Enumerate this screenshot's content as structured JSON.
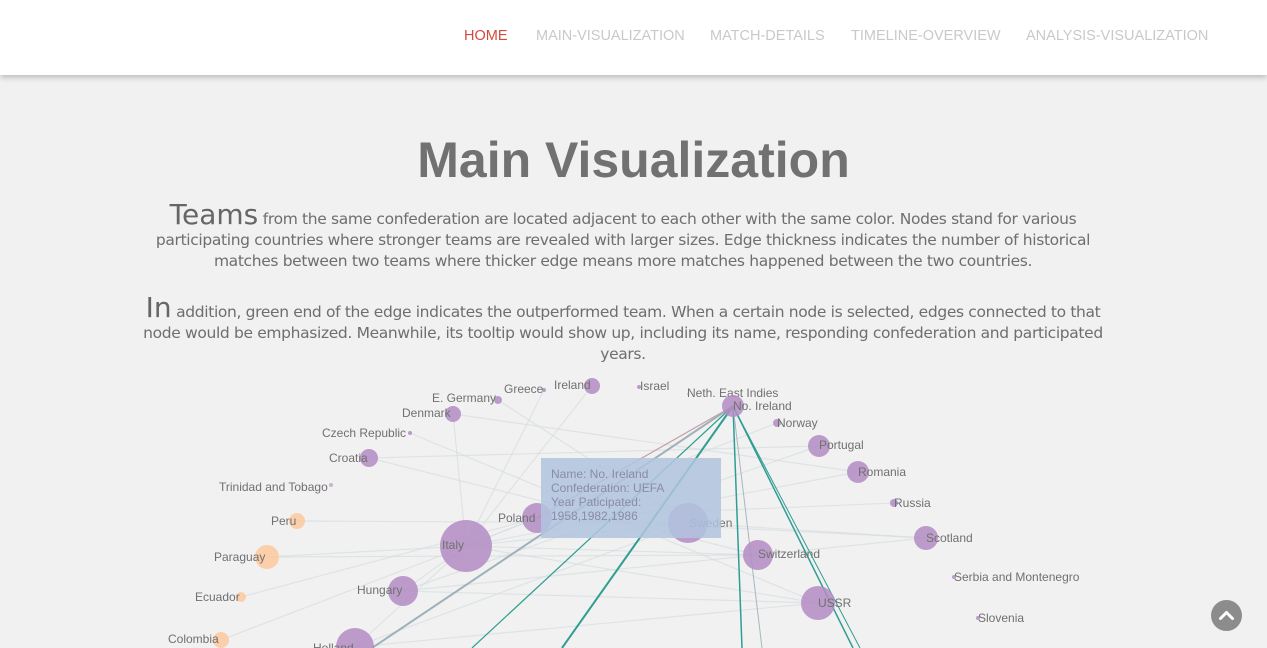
{
  "nav": {
    "items": [
      {
        "label": "HOME",
        "active": true
      },
      {
        "label": "MAIN-VISUALIZATION",
        "active": false
      },
      {
        "label": "MATCH-DETAILS",
        "active": false
      },
      {
        "label": "TIMELINE-OVERVIEW",
        "active": false
      },
      {
        "label": "ANALYSIS-VISUALIZATION",
        "active": false
      }
    ],
    "active_color": "#d2493f",
    "inactive_color": "#c9c9c9"
  },
  "page": {
    "title": "Main Visualization",
    "para1_lead": "Teams",
    "para1_rest": " from the same confederation are located adjacent to each other with the same color. Nodes stand for various participating countries where stronger teams are revealed with larger sizes. Edge thickness indicates the number of historical matches between two teams where thicker edge means more matches happened between the two countries.",
    "para2_lead": "In",
    "para2_rest": " addition, green end of the edge indicates the outperformed team. When a certain node is selected, edges connected to that node would be emphasized. Meanwhile, its tooltip would show up, including its name, responding confederation and participated years."
  },
  "graph": {
    "colors": {
      "uefa": "#b38cc4",
      "conmebol": "#fcc99e",
      "other": "#c4a9c9",
      "edge_highlight": "#2f9e92",
      "edge_faint": "#d5dde0"
    },
    "nodes": [
      {
        "label": "Greece",
        "conf": "UEFA"
      },
      {
        "label": "Ireland",
        "conf": "UEFA"
      },
      {
        "label": "Israel",
        "conf": "UEFA"
      },
      {
        "label": "E. Germany",
        "conf": "UEFA"
      },
      {
        "label": "Neth. East Indies",
        "conf": "AFC"
      },
      {
        "label": "No. Ireland",
        "conf": "UEFA"
      },
      {
        "label": "Denmark",
        "conf": "UEFA"
      },
      {
        "label": "Norway",
        "conf": "UEFA"
      },
      {
        "label": "Czech Republic",
        "conf": "UEFA"
      },
      {
        "label": "Portugal",
        "conf": "UEFA"
      },
      {
        "label": "Croatia",
        "conf": "UEFA"
      },
      {
        "label": "Romania",
        "conf": "UEFA"
      },
      {
        "label": "Trinidad and Tobago",
        "conf": "CONCACAF"
      },
      {
        "label": "Russia",
        "conf": "UEFA"
      },
      {
        "label": "Peru",
        "conf": "CONMEBOL"
      },
      {
        "label": "Poland",
        "conf": "UEFA"
      },
      {
        "label": "Sweden",
        "conf": "UEFA"
      },
      {
        "label": "Scotland",
        "conf": "UEFA"
      },
      {
        "label": "Italy",
        "conf": "UEFA"
      },
      {
        "label": "Paraguay",
        "conf": "CONMEBOL"
      },
      {
        "label": "Switzerland",
        "conf": "UEFA"
      },
      {
        "label": "Serbia and Montenegro",
        "conf": "UEFA"
      },
      {
        "label": "Hungary",
        "conf": "UEFA"
      },
      {
        "label": "Ecuador",
        "conf": "CONMEBOL"
      },
      {
        "label": "USSR",
        "conf": "UEFA"
      },
      {
        "label": "Slovenia",
        "conf": "UEFA"
      },
      {
        "label": "Colombia",
        "conf": "CONMEBOL"
      },
      {
        "label": "Holland",
        "conf": "UEFA"
      }
    ]
  },
  "tooltip": {
    "name": "Name: No. Ireland",
    "confederation": "Confederation: UEFA",
    "year_label": "Year Paticipated:",
    "years": "1958,1982,1986"
  },
  "scroll_top": {
    "icon": "chevron-up-icon"
  }
}
